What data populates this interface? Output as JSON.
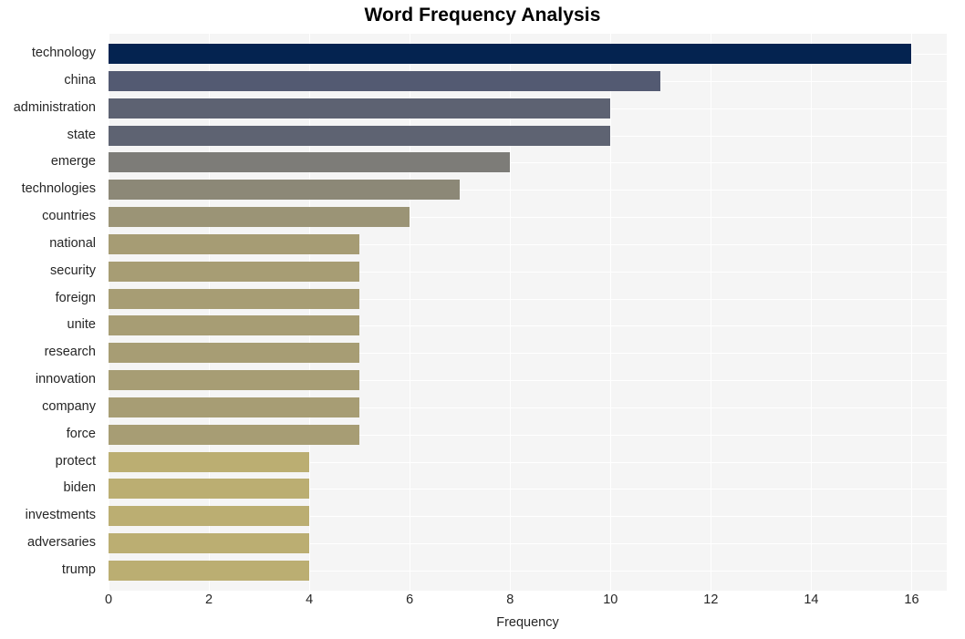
{
  "chart_data": {
    "type": "bar",
    "orientation": "horizontal",
    "title": "Word Frequency Analysis",
    "xlabel": "Frequency",
    "ylabel": "",
    "xlim": [
      0,
      16.7
    ],
    "xticks": [
      0,
      2,
      4,
      6,
      8,
      10,
      12,
      14,
      16
    ],
    "xticklabels": [
      "0",
      "2",
      "4",
      "6",
      "8",
      "10",
      "12",
      "14",
      "16"
    ],
    "grid": true,
    "legend": false,
    "categories": [
      "technology",
      "china",
      "administration",
      "state",
      "emerge",
      "technologies",
      "countries",
      "national",
      "security",
      "foreign",
      "unite",
      "research",
      "innovation",
      "company",
      "force",
      "protect",
      "biden",
      "investments",
      "adversaries",
      "trump"
    ],
    "values": [
      16,
      11,
      10,
      10,
      8,
      7,
      6,
      5,
      5,
      5,
      5,
      5,
      5,
      5,
      5,
      4,
      4,
      4,
      4,
      4
    ],
    "bar_colors": [
      "#042350",
      "#535a72",
      "#5d6272",
      "#5e6372",
      "#7d7c78",
      "#8c8877",
      "#9b9476",
      "#a69c74",
      "#a79d74",
      "#a79d74",
      "#a79d74",
      "#a79d74",
      "#a79d74",
      "#a79d74",
      "#a79d74",
      "#bbae72",
      "#bbae72",
      "#bbae72",
      "#bbae72",
      "#bbae72"
    ],
    "plot_background": "#f5f5f5",
    "gridline_color": "#ffffff",
    "figure_background": "#ffffff",
    "text_color": "#262626"
  }
}
